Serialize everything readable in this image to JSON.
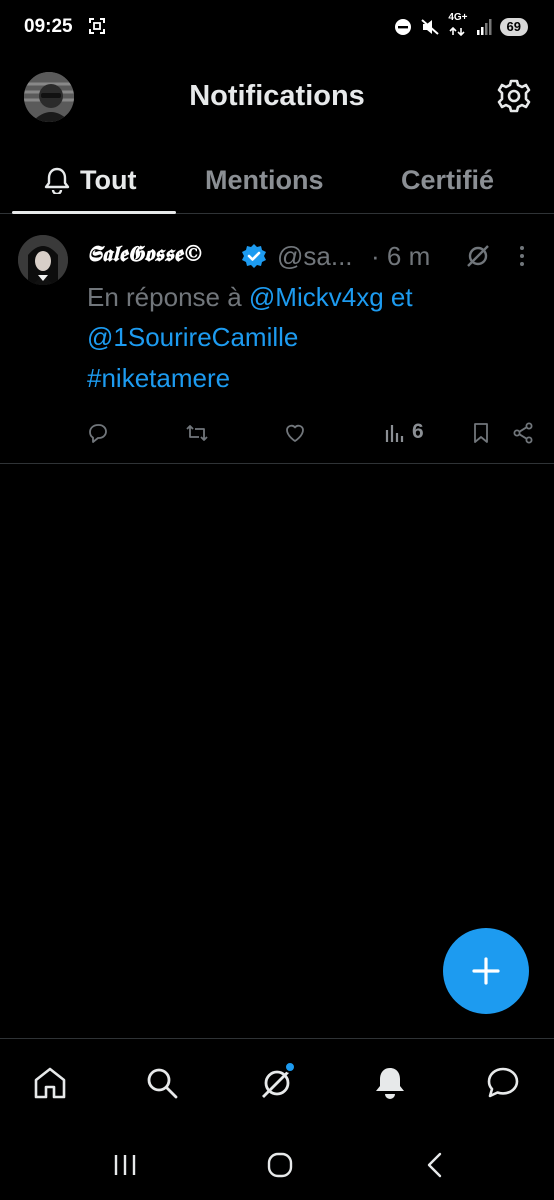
{
  "status_bar": {
    "time": "09:25",
    "network_label": "4G+",
    "battery": "69"
  },
  "header": {
    "title": "Notifications"
  },
  "tabs": [
    {
      "label": "Tout",
      "active": true
    },
    {
      "label": "Mentions",
      "active": false
    },
    {
      "label": "Certifié",
      "active": false
    }
  ],
  "tweet": {
    "display_name": "𝕾𝖆𝖑𝖊𝕲𝖔𝖘𝖘𝖊©",
    "handle": "@sa...",
    "time": "· 6 m",
    "reply_prefix": "En réponse à",
    "reply_user1": "@Mickv4xg",
    "reply_and": "et",
    "reply_user2": "@1SourireCamille",
    "hashtag": "#niketamere",
    "views": "6"
  },
  "colors": {
    "background": "#000000",
    "accent": "#1d9bf0",
    "muted_text": "#71767b",
    "divider": "#2f3336"
  },
  "icons": {
    "settings": "gear-icon",
    "tab_all": "bell-icon",
    "verified": "verified-badge-icon",
    "grok": "grok-icon",
    "more": "more-vertical-icon",
    "reply": "reply-icon",
    "retweet": "retweet-icon",
    "like": "heart-icon",
    "views": "bar-chart-icon",
    "bookmark": "bookmark-icon",
    "share": "share-icon",
    "compose": "plus-icon",
    "nav_home": "home-icon",
    "nav_search": "search-icon",
    "nav_grok": "grok-icon",
    "nav_notifications": "bell-icon",
    "nav_messages": "message-icon"
  }
}
